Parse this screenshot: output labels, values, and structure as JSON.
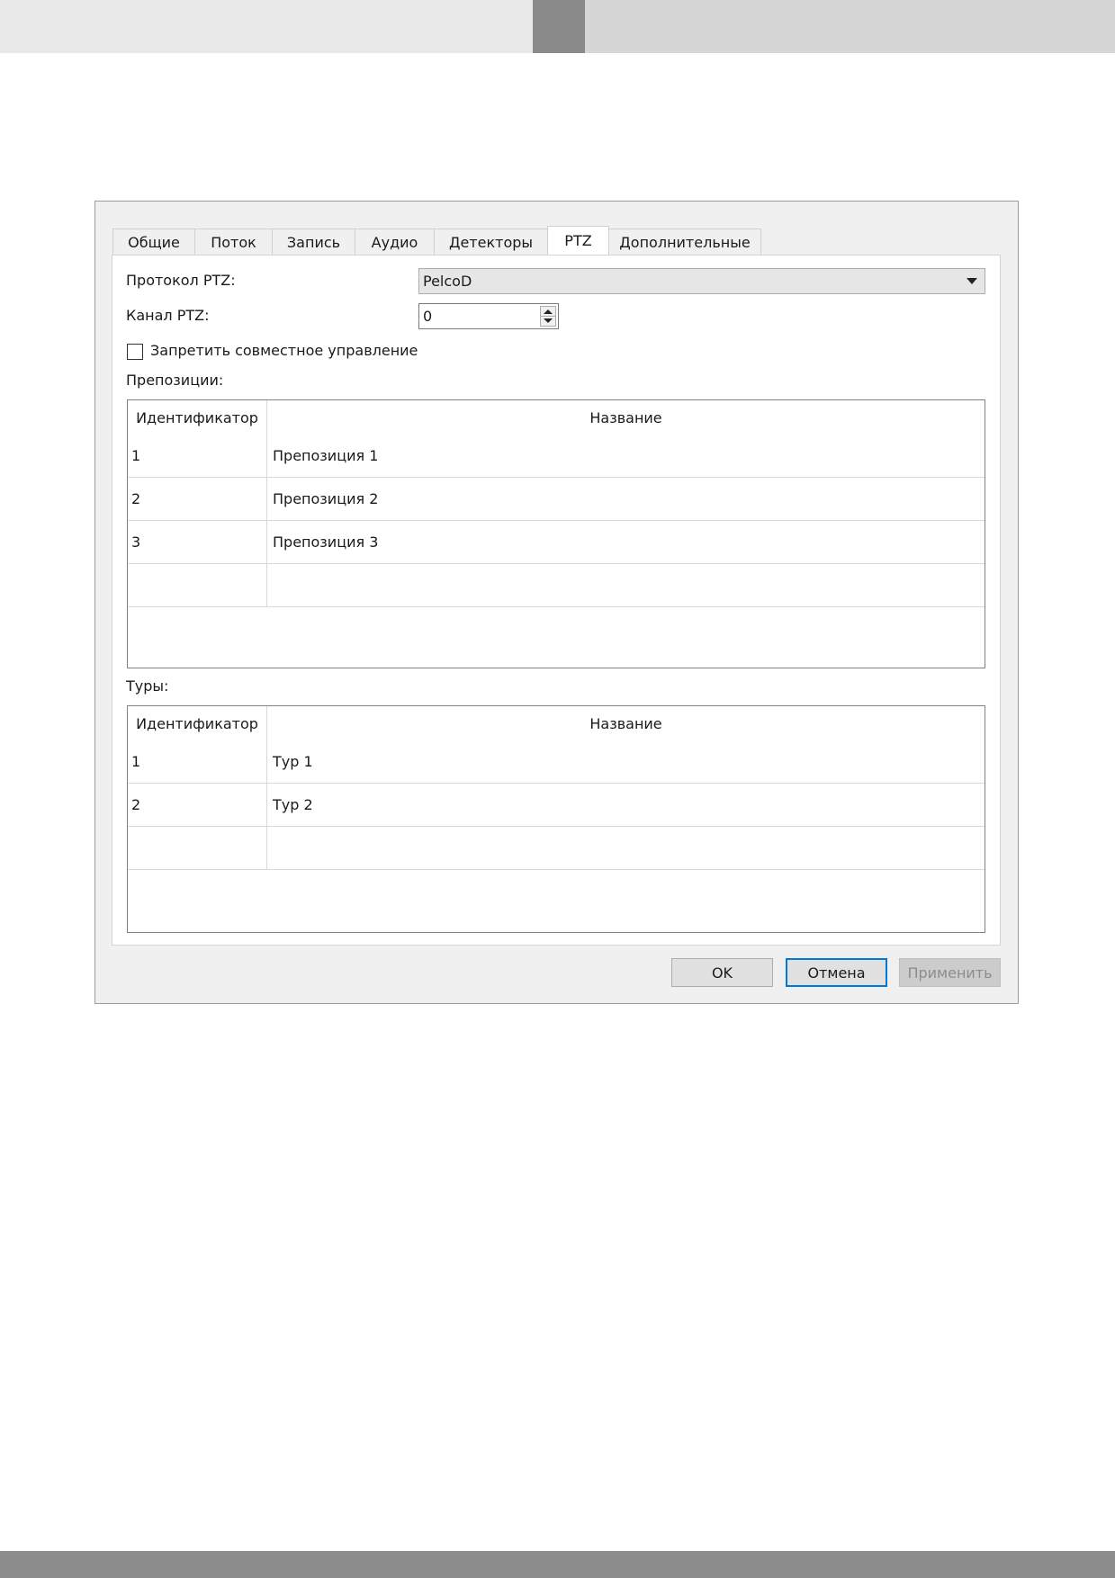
{
  "dialog": {
    "tabs": [
      {
        "label": "Общие"
      },
      {
        "label": "Поток"
      },
      {
        "label": "Запись"
      },
      {
        "label": "Аудио"
      },
      {
        "label": "Детекторы"
      },
      {
        "label": "PTZ",
        "active": true
      },
      {
        "label": "Дополнительные"
      }
    ],
    "protocol": {
      "label": "Протокол PTZ:",
      "value": "PelcoD"
    },
    "channel": {
      "label": "Канал PTZ:",
      "value": "0"
    },
    "disable_shared": {
      "label": "Запретить совместное управление",
      "checked": false
    },
    "presets": {
      "label": "Препозиции:",
      "columns": [
        "Идентификатор",
        "Название"
      ],
      "rows": [
        {
          "id": "1",
          "name": "Препозиция 1"
        },
        {
          "id": "2",
          "name": "Препозиция 2"
        },
        {
          "id": "3",
          "name": "Препозиция 3"
        },
        {
          "id": "",
          "name": ""
        }
      ]
    },
    "tours": {
      "label": "Туры:",
      "columns": [
        "Идентификатор",
        "Название"
      ],
      "rows": [
        {
          "id": "1",
          "name": "Тур 1"
        },
        {
          "id": "2",
          "name": "Тур 2"
        },
        {
          "id": "",
          "name": ""
        }
      ]
    },
    "buttons": {
      "ok": "OK",
      "cancel": "Отмена",
      "apply": "Применить"
    }
  },
  "colors": {
    "accent": "#0078d7",
    "header_dark": "#8a8a8a",
    "footer": "#8c8c8c"
  }
}
